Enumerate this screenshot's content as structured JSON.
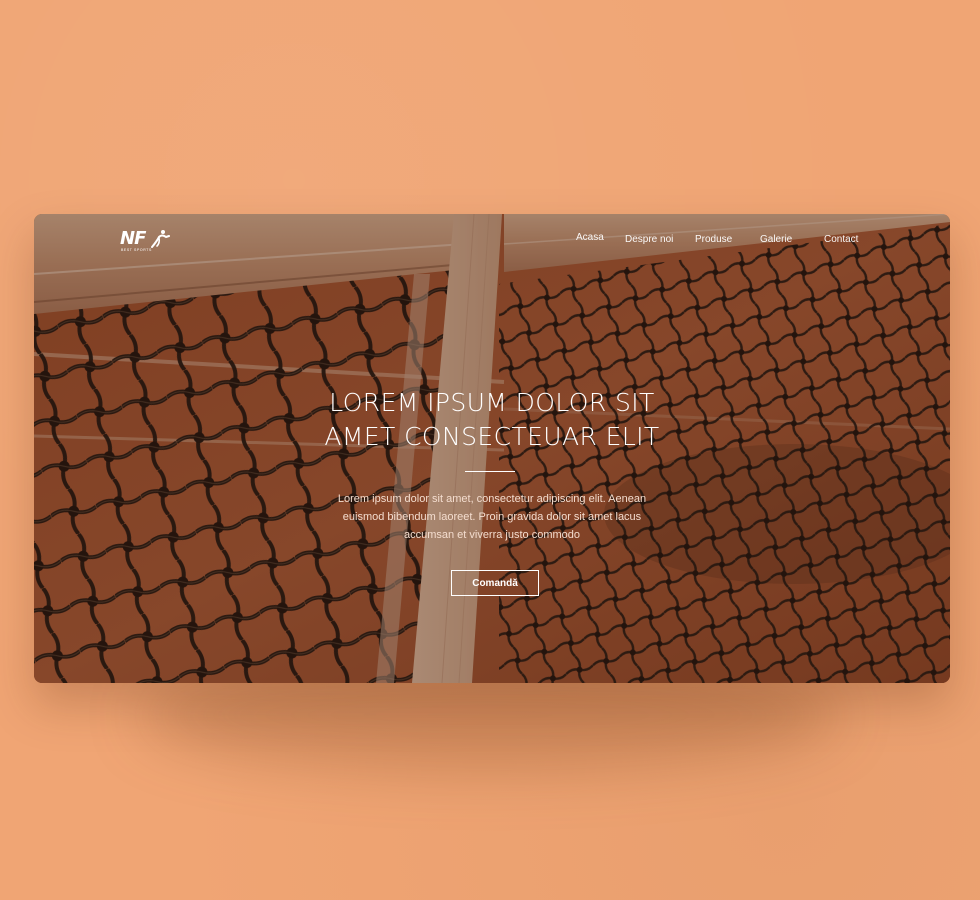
{
  "brand": {
    "logo_text": "NF",
    "tagline": "BEST SPORTS"
  },
  "nav": {
    "items": [
      {
        "label": "Acasa"
      },
      {
        "label": "Despre noi"
      },
      {
        "label": "Produse"
      },
      {
        "label": "Galerie"
      },
      {
        "label": "Contact"
      }
    ]
  },
  "hero": {
    "headline_line1": "LOREM IPSUM DOLOR SIT",
    "headline_line2": "AMET CONSECTEUAR ELIT",
    "description_line1": "Lorem ipsum dolor sit amet, consectetur adipiscing elit. Aenean",
    "description_line2": "euismod bibendum laoreet. Proin gravida dolor sit amet lacus",
    "description_line3": "accumsan et viverra justo commodo",
    "cta_label": "Comandă",
    "background": "tennis net on clay court"
  },
  "colors": {
    "page_background": "#f0a574",
    "clay": "#b8623a",
    "net": "#2b1d16",
    "text": "#ffffff"
  }
}
